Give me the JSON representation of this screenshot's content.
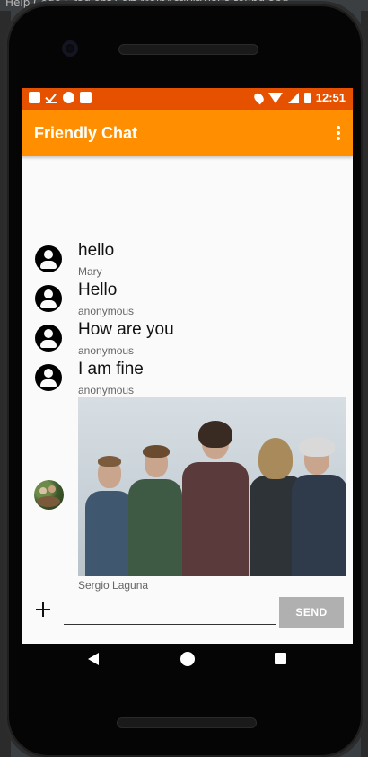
{
  "ide": {
    "menu_text": "Help    Code  Gradient  Sort    MainActivity.java  found  and"
  },
  "status_bar": {
    "time": "12:51"
  },
  "app_bar": {
    "title": "Friendly Chat"
  },
  "messages": [
    {
      "text": "hello",
      "name": "Mary"
    },
    {
      "text": "Hello",
      "name": "anonymous"
    },
    {
      "text": "How are you",
      "name": "anonymous"
    },
    {
      "text": "I am fine",
      "name": "anonymous"
    }
  ],
  "photo_message": {
    "name": "Sergio Laguna"
  },
  "composer": {
    "placeholder": "",
    "send_label": "SEND"
  },
  "colors": {
    "status_bar": "#e65100",
    "app_bar": "#ff8f00",
    "send_button": "#b0b0b0"
  }
}
